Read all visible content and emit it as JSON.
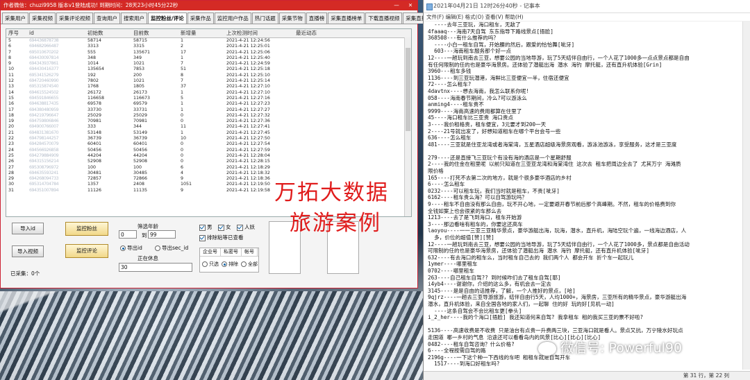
{
  "app": {
    "title": "作者微信：chuzi9958  版本v1登陆成功! 到期时间：28天23小时45分22秒",
    "minimize": "—",
    "close": "✕",
    "tabs": [
      "采集用户",
      "采集视频",
      "采集评论视频",
      "查询用户",
      "搜索用户",
      "监控粉丝/评论",
      "采集作品",
      "监控用户作品",
      "热门话题",
      "采集节物",
      "直播榜",
      "采集直播榜单",
      "下载直播视频",
      "采集直播间弹幕",
      "辅助功能"
    ],
    "active_tab_index": 5,
    "columns": [
      "序号",
      "id",
      "初始数",
      "目前数",
      "新增量",
      "上次检测时间",
      "最近动态"
    ],
    "rows": [
      [
        "5",
        "694436878738",
        "58714",
        "58715",
        "1",
        "2021-4-21 12:24:56"
      ],
      [
        "6",
        "694682966487",
        "3313",
        "3315",
        "2",
        "2021-4-21 12:25:01"
      ],
      [
        "7",
        "695010670202",
        "555",
        "135671",
        "17",
        "2021-4-21 12:25:06"
      ],
      [
        "8",
        "694430097814",
        "348",
        "349",
        "1",
        "2021-4-21 12:25:40"
      ],
      [
        "9",
        "694343937861",
        "1014",
        "1021",
        "7",
        "2021-4-21 12:24:59"
      ],
      [
        "10",
        "694430416377",
        "135654",
        "7853",
        "51",
        "2021-4-21 12:25:18"
      ],
      [
        "11",
        "695341526279",
        "192",
        "200",
        "8",
        "2021-4-21 12:25:10"
      ],
      [
        "12",
        "694720460990",
        "7802",
        "1021",
        "7",
        "2021-4-21 12:25:14"
      ],
      [
        "13",
        "695315874540",
        "1768",
        "1805",
        "37",
        "2021-4-21 12:27:10"
      ],
      [
        "14",
        "694615524502",
        "26172",
        "26173",
        "1",
        "2021-4-21 12:27:10"
      ],
      [
        "15",
        "694591846655",
        "116658",
        "116673",
        "5",
        "2021-4-21 12:27:16"
      ],
      [
        "16",
        "694638817435",
        "69578",
        "69579",
        "1",
        "2021-4-21 12:27:23"
      ],
      [
        "17",
        "694380480959",
        "33730",
        "33731",
        "1",
        "2021-4-21 12:27:27"
      ],
      [
        "18",
        "694219796647",
        "25029",
        "25029",
        "0",
        "2021-4-21 12:27:32"
      ],
      [
        "19",
        "694759806846",
        "70981",
        "70981",
        "0",
        "2021-4-21 12:27:36"
      ],
      [
        "20",
        "694900766007",
        "333",
        "344",
        "11",
        "2021-4-21 12:27:41"
      ],
      [
        "21",
        "694831381670",
        "53148",
        "53149",
        "1",
        "2021-4-21 12:27:45"
      ],
      [
        "22",
        "694798144257",
        "36739",
        "36739",
        "10",
        "2021-4-21 12:27:50"
      ],
      [
        "23",
        "694284570079",
        "60401",
        "60401",
        "0",
        "2021-4-21 12:27:54"
      ],
      [
        "24",
        "694566926858",
        "50456",
        "50456",
        "0",
        "2021-4-21 12:27:59"
      ],
      [
        "25",
        "694279884909",
        "44204",
        "44204",
        "0",
        "2021-4-21 12:28:04"
      ],
      [
        "26",
        "694315156214",
        "52908",
        "52908",
        "0",
        "2021-4-21 12:28:15"
      ],
      [
        "27",
        "695308796972",
        "100",
        "100",
        "6",
        "2021-4-21 12:18:29"
      ],
      [
        "28",
        "694635593241",
        "30481",
        "30485",
        "4",
        "2021-4-21 12:18:32"
      ],
      [
        "29",
        "694268094733",
        "72857",
        "72866",
        "9",
        "2021-4-21 12:18:36"
      ],
      [
        "30",
        "695314704784",
        "1357",
        "2408",
        "1051",
        "2021-4-21 12:19:50"
      ],
      [
        "31",
        "694351007894",
        "11126",
        "11135",
        "9",
        "2021-4-21 12:19:58"
      ]
    ],
    "buttons": {
      "import_id": "导入id",
      "monitor_fans": "监控粉丝",
      "import_video": "导入视频",
      "monitor_comments": "监控评论"
    },
    "filter_label": "筛选年龄",
    "age_from": "0",
    "age_to_label": "到",
    "age_to": "99",
    "export_id": "导出id",
    "export_sec_id": "导出sec_id",
    "rest_label": "正在休息",
    "rest_value": "30",
    "checks": {
      "male": "男",
      "female": "女",
      "person": "人妖",
      "exclude": "排除粘等已查看"
    },
    "group_tabs": [
      "企业号",
      "私密号",
      "帐号"
    ],
    "group_radios": [
      "只选",
      "排除",
      "全部"
    ],
    "collected_label": "已采集：0个"
  },
  "watermark": [
    "万拓大数据",
    "旅游案例"
  ],
  "notepad": {
    "title": "2021年04月21日 12时26分40秒 - 记事本",
    "menu": "文件(F)  编辑(E)  格式(O)  查看(V)  帮助(H)",
    "lines": [
      "  ----去年三亚玩，海口租车，无敌了",
      "4faaaq---海南7天自驾 东东指导下路线景点[捂脸]",
      "368508---有什么推荐的吗？",
      "  ----小白一租车自驾，开始腰的然后，跟爱的恰恰舞[呲牙]",
      "  603---海南租车服务那个好一点",
      "12----一趟玩到南去三亚，想要公园的当地导游，玩了5天结伴自由行，一个人花了1000多一点点景点都是自由",
      "有任何限制的任的也是豪华海景房。还体验了潜艇出海 潜水 海钓 摩托艇，还有直升机体验[Grin]",
      "3960---租车多钱",
      "1136----到三亚玩潜港，海鲜比三亚便宜一半，住宿还便宜",
      "72----怎么租车?",
      "4davtnx----想去海南，我怎么联系你呢!",
      "058----海南春节期间，冷么?可以游泳么",
      "anming4----租车贵不",
      "9999----海南高速的费用都算在住里了",
      "45----海口租车比三亚贵 海口贵点",
      "3----我价租格贵，租车便宜，3元要才到200一天",
      "2----21号就出发了，好想知道租车在哪个平台会号一些",
      "636----怎么租车",
      "481----三亚就是住亚龙湾或者海棠湾，五星酒店超级海景房观看，游泳池游泳，享受服务，这才是三亚度",
      "",
      "279----还是直接飞三亚玩个有没有海的酒店是一个星期舒服",
      "2----我的住金在租里呢 以前只知道在三亚亚龙湾和海棠湾住 这次去 租车把周边全去了 尤其万宁 海滩质",
      "限价格",
      "165----打死不去第二次的地方，就是个很多豪华酒店的乡村",
      "6----怎么租车",
      "0232----可以租车玩，我们当时就是租车，不贵[呲牙]",
      "6162----租车贵么海？可以自驾游玩吗？",
      "9----租车不自由没有那么自由，玩不开心地，一定要避开春节前后那个高峰期。不然，租车的价格费到你",
      "全钱如案上也会很紧的车那么去",
      "1213----去了是飞到海口，租车开始游",
      "3----那边看啥有租车的，你要这还高车",
      "laoyou----一一三亚三亚精华景点，豪华游艇出海，玩海，潜水，直升机，海陆空玩个遍，一线海边酒店，人",
      "  多，价位的超值[赞][赞]",
      "12----一趟玩到南去三亚，想要公园的当地导游，玩了5天结伴自由行，一个人花了1000多，景点都是自由活动",
      "可限制的任的也是豪华海景房，还体验了潜艇出海 潜水 海钓 摩托艇，还有直升机体验[呲牙]",
      "632----有去海口的租车么，当时租车自己去的 我们两个人 都会开车 折个车一起玩儿",
      "1ymer----哪里租车",
      "0702----哪里租车",
      "263----自己租车自驾?? 到时候咋们去了租车自驾[耶]",
      "i4yb4----谢谢你，介绍的这么多，有机会去一定去",
      "3145----是是自由的话推荐，了解，一个人推好的景点，[哈]",
      "9qjrz----一趟去三亚导游旅游，结伴自由行5天，人均1000+，海景房，三亚所有的精华景点，豪华游艇出海",
      "潜水，直升机体验，来自全国各地的家人们，一起聊 住的好 玩的好[见机一动]",
      "  ----这条自驾会不会比租车更[拳头]",
      "i_2_her----我的个海口[捂脸] 我还知道何来自驾? 我拿租车 租的我买三亚的票不好啦?",
      "",
      "5136----高速收费是不收费 只是油台有点贵一升费两三块，三亚海口就是看人。景点又抗，万宁陵水好玩点",
      "走国道 哪一乡村的气息 沿途还可以看看岛内的风景[比心][比心][比心]",
      "0482----租车自驾咨询？什么价格?",
      "6----全程按需自驾的路",
      "2196g----一下这个种一下西线的车吧 租租车就是自驾开车",
      "  1517----到海口好租车吗?"
    ],
    "status": "第 31 行，第 22 列"
  },
  "wechat": "微信号: Powerful90"
}
